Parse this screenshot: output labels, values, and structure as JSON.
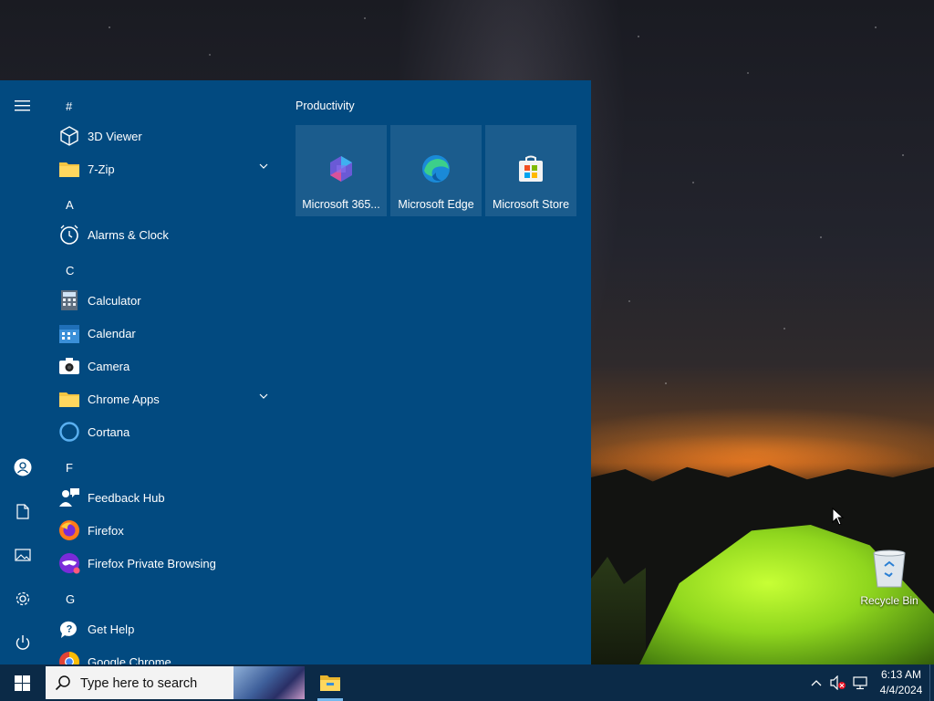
{
  "start_menu": {
    "rail": {
      "items": [
        "menu-icon",
        "user-icon",
        "document-icon",
        "pictures-icon",
        "settings-icon",
        "power-icon"
      ]
    },
    "app_list": [
      {
        "type": "letter",
        "text": "#"
      },
      {
        "type": "app",
        "label": "3D Viewer",
        "icon": "cube-icon"
      },
      {
        "type": "folder",
        "label": "7-Zip",
        "icon": "folder-icon",
        "expandable": true
      },
      {
        "type": "letter",
        "text": "A"
      },
      {
        "type": "app",
        "label": "Alarms & Clock",
        "icon": "clock-icon"
      },
      {
        "type": "letter",
        "text": "C"
      },
      {
        "type": "app",
        "label": "Calculator",
        "icon": "calculator-icon"
      },
      {
        "type": "app",
        "label": "Calendar",
        "icon": "calendar-icon"
      },
      {
        "type": "app",
        "label": "Camera",
        "icon": "camera-icon"
      },
      {
        "type": "folder",
        "label": "Chrome Apps",
        "icon": "folder-icon",
        "expandable": true
      },
      {
        "type": "app",
        "label": "Cortana",
        "icon": "cortana-icon"
      },
      {
        "type": "letter",
        "text": "F"
      },
      {
        "type": "app",
        "label": "Feedback Hub",
        "icon": "feedback-icon"
      },
      {
        "type": "app",
        "label": "Firefox",
        "icon": "firefox-icon"
      },
      {
        "type": "app",
        "label": "Firefox Private Browsing",
        "icon": "firefox-private-icon"
      },
      {
        "type": "letter",
        "text": "G"
      },
      {
        "type": "app",
        "label": "Get Help",
        "icon": "help-icon"
      },
      {
        "type": "app",
        "label": "Google Chrome",
        "icon": "chrome-icon"
      }
    ],
    "tiles": {
      "group_title": "Productivity",
      "items": [
        {
          "label": "Microsoft 365...",
          "icon": "microsoft-365-icon"
        },
        {
          "label": "Microsoft Edge",
          "icon": "edge-icon"
        },
        {
          "label": "Microsoft Store",
          "icon": "store-icon"
        }
      ]
    }
  },
  "desktop": {
    "icons": [
      {
        "label": "Recycle Bin",
        "icon": "recycle-bin-icon"
      }
    ]
  },
  "taskbar": {
    "search_placeholder": "Type here to search",
    "pinned": [
      "file-explorer-icon"
    ],
    "tray": [
      "chevron-up-icon",
      "volume-muted-icon",
      "network-icon"
    ],
    "time": "6:13 AM",
    "date": "4/4/2024"
  },
  "colors": {
    "start_menu_bg": "#024a80",
    "taskbar_bg": "#0b2a47",
    "tile_bg": "rgba(255,255,255,0.10)"
  }
}
